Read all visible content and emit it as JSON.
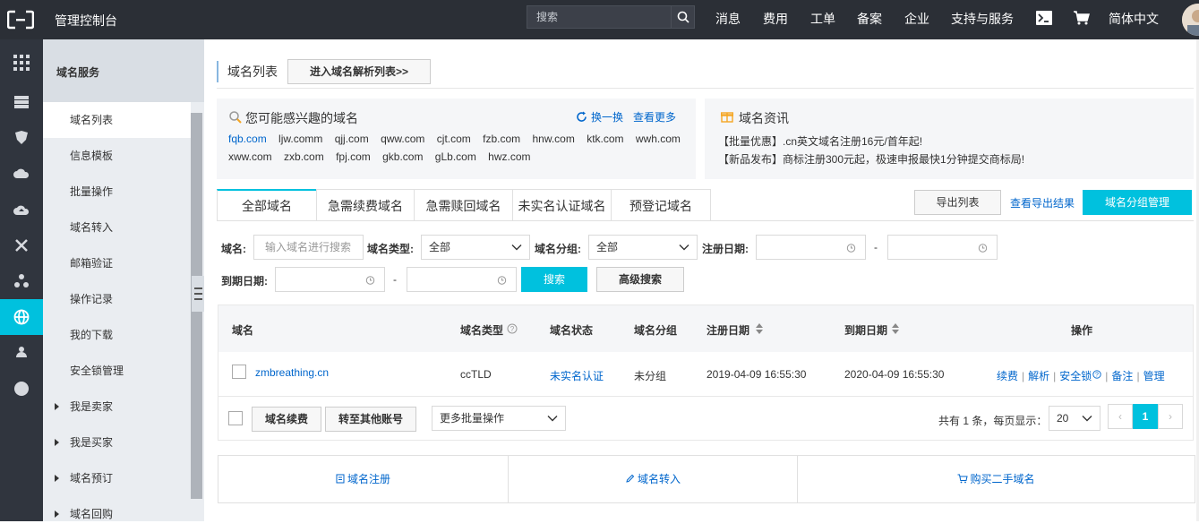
{
  "topbar": {
    "title": "管理控制台",
    "search_placeholder": "搜索",
    "nav": [
      "消息",
      "费用",
      "工单",
      "备案",
      "企业",
      "支持与服务"
    ],
    "language": "简体中文"
  },
  "sidebar": {
    "header": "域名服务",
    "items": [
      "域名列表",
      "信息模板",
      "批量操作",
      "域名转入",
      "邮箱验证",
      "操作记录",
      "我的下载",
      "安全锁管理"
    ],
    "groups": [
      "我是卖家",
      "我是买家",
      "域名预订",
      "域名回购"
    ]
  },
  "main": {
    "page_title": "域名列表",
    "enter_dns_button": "进入域名解析列表>>",
    "interest_panel": {
      "title": "您可能感兴趣的域名",
      "swap": "换一换",
      "more": "查看更多",
      "row1": [
        "fqb.com",
        "ljw.comm",
        "qjj.com",
        "qww.com",
        "cjt.com",
        "fzb.com",
        "hnw.com",
        "ktk.com",
        "wwh.com"
      ],
      "row2": [
        "xww.com",
        "zxb.com",
        "fpj.com",
        "gkb.com",
        "gLb.com",
        "hwz.com"
      ]
    },
    "news_panel": {
      "title": "域名资讯",
      "line1": "【批量优惠】.cn英文域名注册16元/首年起!",
      "line2": "【新品发布】商标注册300元起，极速申报最快1分钟提交商标局!"
    },
    "tabs": [
      "全部域名",
      "急需续费域名",
      "急需赎回域名",
      "未实名认证域名",
      "预登记域名"
    ],
    "export_button": "导出列表",
    "view_export_link": "查看导出结果",
    "group_manage_button": "域名分组管理",
    "filters": {
      "domain_label": "域名:",
      "domain_placeholder": "输入域名进行搜索",
      "type_label": "域名类型:",
      "type_value": "全部",
      "group_label": "域名分组:",
      "group_value": "全部",
      "reg_date_label": "注册日期:",
      "exp_date_label": "到期日期:",
      "dash": "-",
      "search_button": "搜索",
      "advanced_button": "高级搜索"
    },
    "table": {
      "headers": [
        "域名",
        "域名类型",
        "域名状态",
        "域名分组",
        "注册日期",
        "到期日期",
        "操作"
      ],
      "rows": [
        {
          "domain": "zmbreathing.cn",
          "type": "ccTLD",
          "status": "未实名认证",
          "group": "未分组",
          "reg_date": "2019-04-09 16:55:30",
          "exp_date": "2020-04-09 16:55:30",
          "ops": [
            "续费",
            "解析",
            "安全锁",
            "备注",
            "管理"
          ]
        }
      ],
      "renew_button": "域名续费",
      "transfer_button": "转至其他账号",
      "batch_select": "更多批量操作",
      "total_text": "共有 1 条，每页显示：",
      "page_size": "20",
      "current_page": "1",
      "prev": "‹",
      "next": "›"
    },
    "bottom": {
      "register": "域名注册",
      "transfer_in": "域名转入",
      "buy_second_hand": "购买二手域名"
    }
  },
  "colors": {
    "accent": "#00c1de",
    "topbar_bg": "#2b2f36",
    "iconbar_bg": "#30353e",
    "link": "#0066cc"
  }
}
